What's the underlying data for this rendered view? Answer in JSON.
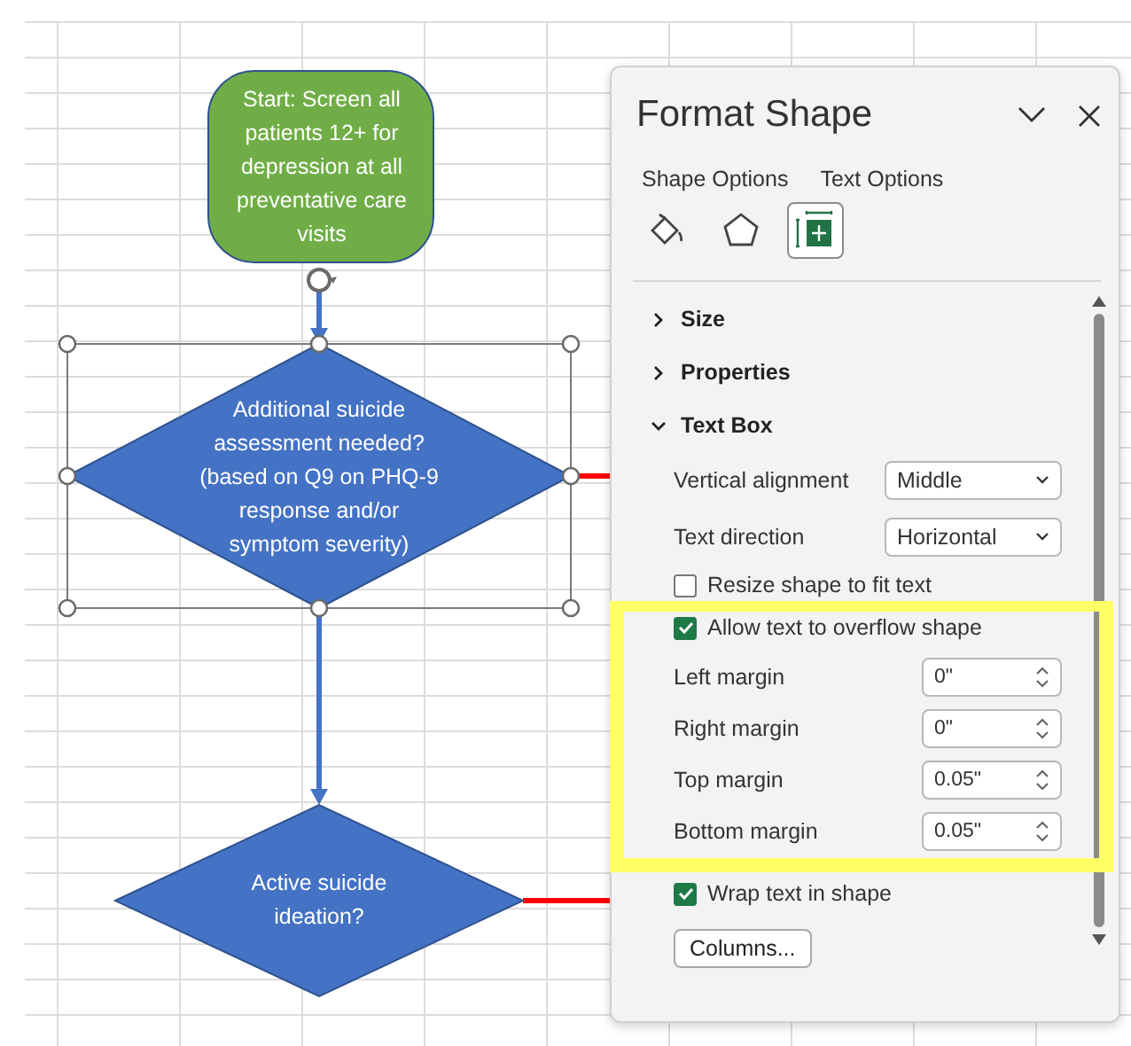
{
  "flowchart": {
    "nodes": [
      {
        "kind": "terminator",
        "text": "Start: Screen all patients 12+ for depression at all preventative care visits",
        "selected": false
      },
      {
        "kind": "decision",
        "text": "Additional suicide assessment needed? (based on Q9 on PHQ-9 response and/or symptom severity)",
        "selected": true
      },
      {
        "kind": "decision",
        "text": "Active suicide ideation?",
        "selected": false
      }
    ]
  },
  "panel": {
    "title": "Format Shape",
    "tabs": [
      {
        "label": "Shape Options"
      },
      {
        "label": "Text Options"
      }
    ],
    "icon_tabs": [
      {
        "kind": "fill",
        "selected": false
      },
      {
        "kind": "effects",
        "selected": false
      },
      {
        "kind": "layout",
        "selected": true
      }
    ],
    "sections": [
      {
        "label": "Size",
        "expanded": false
      },
      {
        "label": "Properties",
        "expanded": false
      },
      {
        "label": "Text Box",
        "expanded": true
      }
    ],
    "controls": [
      {
        "kind": "dropdown",
        "label": "Vertical alignment",
        "value": "Middle"
      },
      {
        "kind": "dropdown",
        "label": "Text direction",
        "value": "Horizontal"
      },
      {
        "kind": "checkbox",
        "label": "Resize shape to fit text",
        "checked": false
      },
      {
        "kind": "checkbox",
        "label": "Allow text to overflow shape",
        "checked": true
      },
      {
        "kind": "spin",
        "label": "Left margin",
        "value": "0\""
      },
      {
        "kind": "spin",
        "label": "Right margin",
        "value": "0\""
      },
      {
        "kind": "spin",
        "label": "Top margin",
        "value": "0.05\""
      },
      {
        "kind": "spin",
        "label": "Bottom margin",
        "value": "0.05\""
      },
      {
        "kind": "checkbox",
        "label": "Wrap text in shape",
        "checked": true
      },
      {
        "kind": "button",
        "label": "Columns..."
      }
    ]
  }
}
